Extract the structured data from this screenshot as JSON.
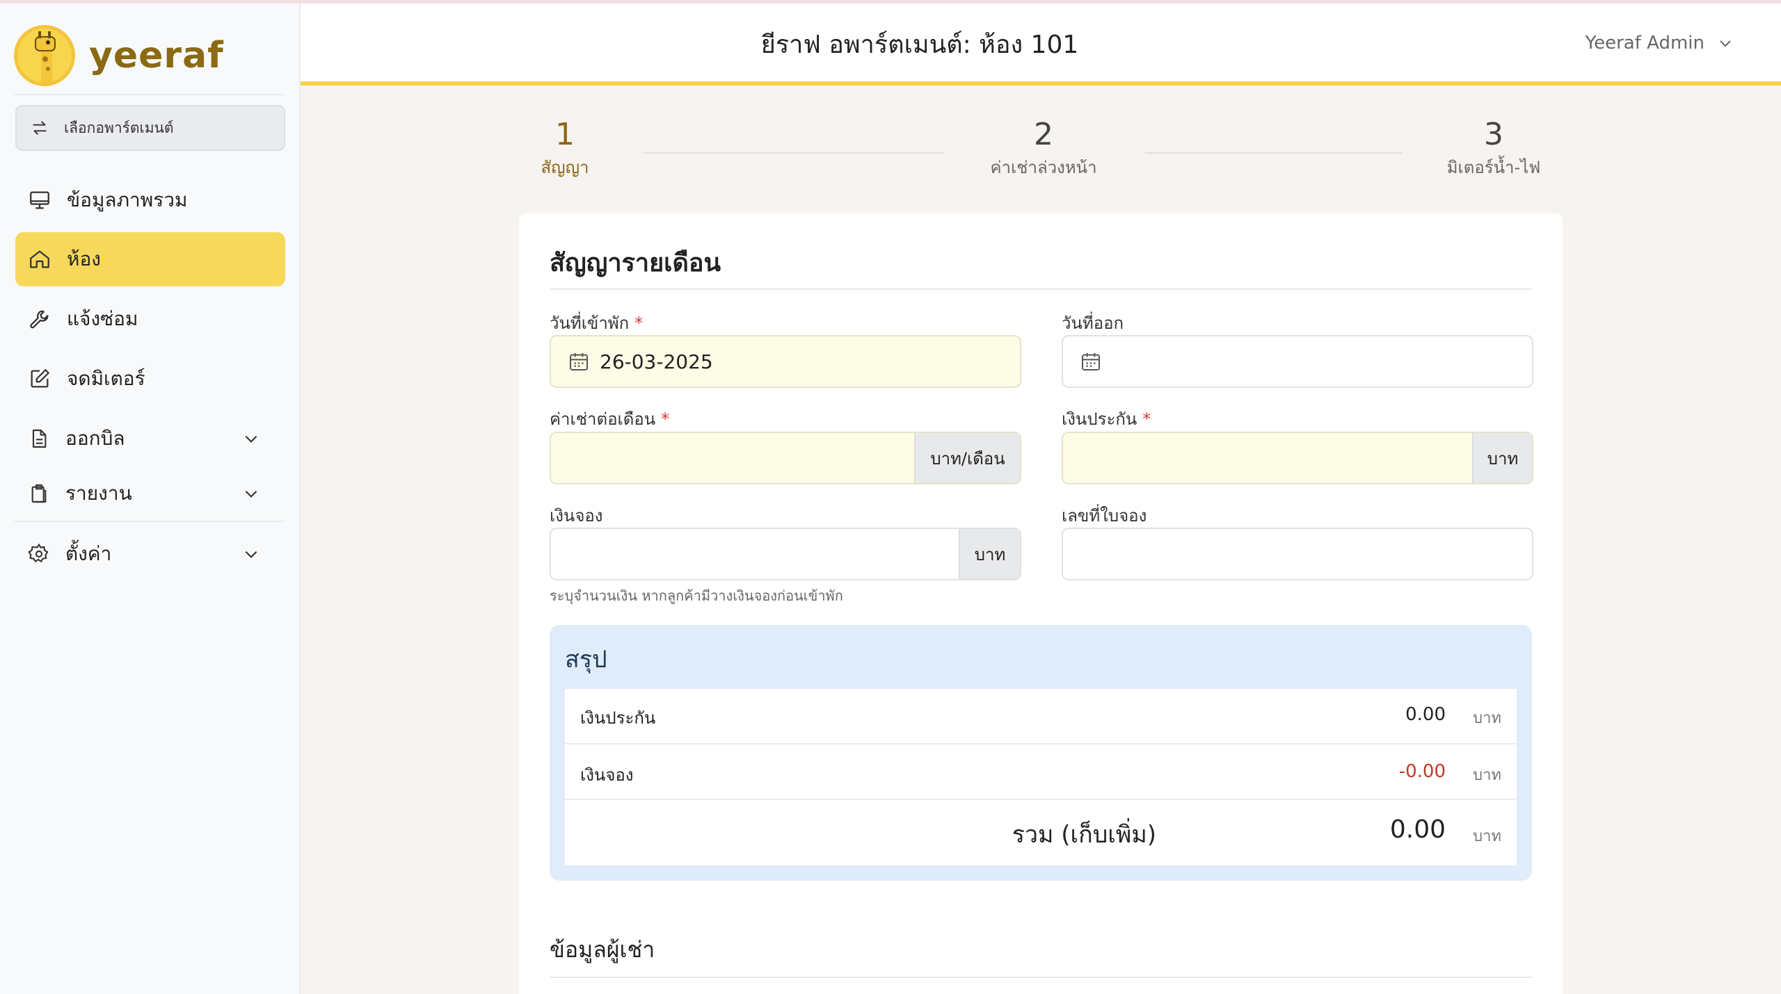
{
  "app": {
    "logo_text": "yeeraf",
    "title": "ยีราฟ อพาร์ตเมนต์: ห้อง 101",
    "admin_name": "Yeeraf Admin"
  },
  "sidebar": {
    "apartment_select": "เลือกอพาร์ตเมนต์",
    "items": [
      {
        "label": "ข้อมูลภาพรวม",
        "icon": "monitor-icon"
      },
      {
        "label": "ห้อง",
        "icon": "home-icon",
        "active": true
      },
      {
        "label": "แจ้งซ่อม",
        "icon": "wrench-icon"
      },
      {
        "label": "จดมิเตอร์",
        "icon": "edit-icon"
      },
      {
        "label": "ออกบิล",
        "icon": "document-icon",
        "expandable": true
      },
      {
        "label": "รายงาน",
        "icon": "clipboard-icon",
        "expandable": true
      },
      {
        "label": "ตั้งค่า",
        "icon": "gear-icon",
        "expandable": true
      }
    ]
  },
  "steps": [
    {
      "num": "1",
      "label": "สัญญา",
      "active": true
    },
    {
      "num": "2",
      "label": "ค่าเช่าล่วงหน้า"
    },
    {
      "num": "3",
      "label": "มิเตอร์น้ำ-ไฟ"
    }
  ],
  "form": {
    "title": "สัญญารายเดือน",
    "required_mark": "*",
    "move_in": {
      "label": "วันที่เข้าพัก",
      "value": "26-03-2025"
    },
    "move_out": {
      "label": "วันที่ออก",
      "value": ""
    },
    "monthly_rent": {
      "label": "ค่าเช่าต่อเดือน",
      "value": "",
      "unit": "บาท/เดือน"
    },
    "deposit": {
      "label": "เงินประกัน",
      "value": "",
      "unit": "บาท"
    },
    "booking_fee": {
      "label": "เงินจอง",
      "value": "",
      "unit": "บาท",
      "helper": "ระบุจำนวนเงิน หากลูกค้ามีวางเงินจองก่อนเข้าพัก"
    },
    "booking_no": {
      "label": "เลขที่ใบจอง",
      "value": ""
    }
  },
  "summary": {
    "title": "สรุป",
    "rows": [
      {
        "label": "เงินประกัน",
        "amount": "0.00",
        "unit": "บาท"
      },
      {
        "label": "เงินจอง",
        "amount": "-0.00",
        "unit": "บาท"
      }
    ],
    "total": {
      "label": "รวม (เก็บเพิ่ม)",
      "amount": "0.00",
      "unit": "บาท"
    }
  },
  "tenant": {
    "title": "ข้อมูลผู้เช่า"
  },
  "colors": {
    "accent": "#f6d34a",
    "active_nav": "#f6d85a",
    "summary_bg": "#e0ecfa",
    "negative": "#c0392b",
    "required": "#d63b3b"
  }
}
